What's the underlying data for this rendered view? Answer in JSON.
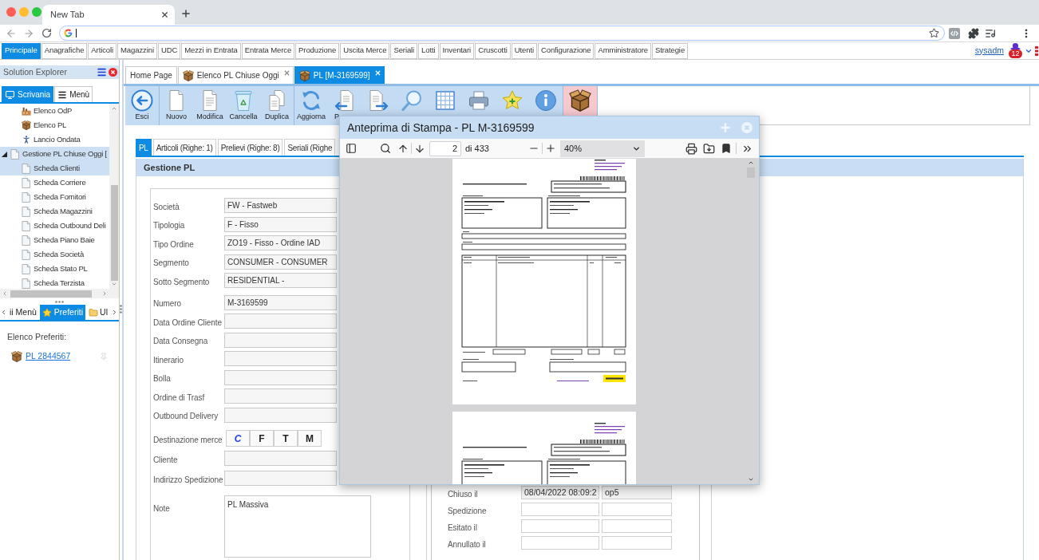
{
  "browser": {
    "tabs": [
      {
        "label": "New Tab",
        "selected": true
      }
    ]
  },
  "menu_bar": {
    "items": [
      {
        "label": "Principale",
        "selected": true
      },
      {
        "label": "Anagrafiche",
        "selected": false
      },
      {
        "label": "Articoli",
        "selected": false
      },
      {
        "label": "Magazzini",
        "selected": false
      },
      {
        "label": "UDC",
        "selected": false
      },
      {
        "label": "Mezzi in Entrata",
        "selected": false
      },
      {
        "label": "Entrata Merce",
        "selected": false
      },
      {
        "label": "Produzione",
        "selected": false
      },
      {
        "label": "Uscita Merce",
        "selected": false
      },
      {
        "label": "Seriali",
        "selected": false
      },
      {
        "label": "Lotti",
        "selected": false
      },
      {
        "label": "Inventari",
        "selected": false
      },
      {
        "label": "Cruscotti",
        "selected": false
      },
      {
        "label": "Utenti",
        "selected": false
      },
      {
        "label": "Configurazione",
        "selected": false
      },
      {
        "label": "Amministratore",
        "selected": false
      },
      {
        "label": "Strategie",
        "selected": false
      }
    ],
    "user": "sysadm",
    "notifications": "12"
  },
  "solution_explorer": {
    "title": "Solution Explorer",
    "tabs": [
      {
        "label": "Scrivania",
        "kind": "desktop",
        "selected": true
      },
      {
        "label": "Menù",
        "kind": "menu",
        "selected": false
      }
    ],
    "tree": [
      {
        "children": [
          {
            "label": "Elenco OdP",
            "kind": "factory",
            "selected": false
          },
          {
            "label": "Elenco PL",
            "kind": "package",
            "selected": false
          },
          {
            "label": "Lancio Ondata",
            "kind": "person",
            "selected": false
          }
        ]
      },
      {
        "label": "Gestione PL Chiuse Oggi [",
        "kind": "page",
        "selected": true,
        "expanded": true,
        "children": [
          {
            "label": "Scheda Clienti",
            "kind": "page",
            "selected": true
          },
          {
            "label": "Scheda Corriere",
            "kind": "page",
            "selected": false
          },
          {
            "label": "Scheda Fornitori",
            "kind": "page",
            "selected": false
          },
          {
            "label": "Scheda Magazzini",
            "kind": "page",
            "selected": false
          },
          {
            "label": "Scheda Outbound Deli",
            "kind": "page",
            "selected": false
          },
          {
            "label": "Scheda Piano Baie",
            "kind": "page",
            "selected": false
          },
          {
            "label": "Scheda Società",
            "kind": "page",
            "selected": false
          },
          {
            "label": "Scheda Stato PL",
            "kind": "page",
            "selected": false
          },
          {
            "label": "Scheda Terzista",
            "kind": "page",
            "selected": false
          }
        ]
      }
    ],
    "bottom_tabs": [
      {
        "label": "ii Menù",
        "kind": "plain",
        "selected": false
      },
      {
        "label": "Preferiti",
        "kind": "star",
        "selected": true
      },
      {
        "label": "Ul",
        "kind": "folder",
        "selected": false
      }
    ],
    "favorites": {
      "title": "Elenco Preferiti:",
      "items": [
        {
          "label": "PL 2844567",
          "kind": "package"
        }
      ]
    }
  },
  "tabs": [
    {
      "label": "Home Page",
      "kind": "plain",
      "selected": false,
      "closable": false
    },
    {
      "label": "Elenco PL Chiuse Oggi",
      "kind": "package",
      "selected": false,
      "closable": true
    },
    {
      "label": "PL [M-3169599]",
      "kind": "package",
      "selected": true,
      "closable": true
    }
  ],
  "toolbar": {
    "groups": [
      {
        "highlighted": false,
        "buttons": [
          {
            "kind": "exit",
            "label": "Esci"
          }
        ]
      },
      {
        "highlighted": false,
        "buttons": [
          {
            "kind": "new",
            "label": "Nuovo"
          },
          {
            "kind": "edit",
            "label": "Modifica"
          },
          {
            "kind": "delete",
            "label": "Cancella"
          },
          {
            "kind": "duplicate",
            "label": "Duplica"
          }
        ]
      },
      {
        "highlighted": false,
        "buttons": [
          {
            "kind": "refresh",
            "label": "Aggiorna"
          },
          {
            "kind": "import",
            "label": "P"
          },
          {
            "kind": "export"
          },
          {
            "kind": "search"
          },
          {
            "kind": "grid"
          },
          {
            "kind": "print"
          },
          {
            "kind": "favorite"
          },
          {
            "kind": "info"
          }
        ]
      },
      {
        "highlighted": true,
        "buttons": [
          {
            "kind": "package"
          }
        ]
      }
    ]
  },
  "form_tabs": [
    {
      "label": "PL",
      "selected": true
    },
    {
      "label": "Articoli (Righe: 1)",
      "selected": false
    },
    {
      "label": "Prelievi (Righe: 8)",
      "selected": false
    },
    {
      "label": "Seriali (Righe",
      "selected": false
    }
  ],
  "panel": {
    "title": "Gestione PL",
    "field_groups": [
      {
        "fields": [
          {
            "kind": "text",
            "label": "Società",
            "value": "FW - Fastweb"
          },
          {
            "kind": "text",
            "label": "Tipologia",
            "value": "F - Fisso"
          },
          {
            "kind": "text",
            "label": "Tipo Ordine",
            "value": "ZO19 - Fisso - Ordine IAD"
          },
          {
            "kind": "text",
            "label": "Segmento",
            "value": "CONSUMER - CONSUMER"
          },
          {
            "kind": "text",
            "label": "Sotto Segmento",
            "value": "RESIDENTIAL -"
          }
        ]
      },
      {
        "fields": [
          {
            "kind": "text",
            "label": "Numero",
            "value": "M-3169599"
          },
          {
            "kind": "text",
            "label": "Data Ordine Cliente"
          },
          {
            "kind": "text",
            "label": "Data Consegna"
          },
          {
            "kind": "text",
            "label": "Itinerario"
          },
          {
            "kind": "text",
            "label": "Bolla"
          },
          {
            "kind": "text",
            "label": "Ordine di Trasf"
          },
          {
            "kind": "text",
            "label": "Outbound Delivery"
          }
        ]
      },
      {
        "fields": [
          {
            "kind": "choice",
            "label": "Destinazione merce",
            "options": [
              {
                "label": "C",
                "selected": true
              },
              {
                "label": "F",
                "selected": false
              },
              {
                "label": "T",
                "selected": false
              },
              {
                "label": "M",
                "selected": false
              }
            ]
          },
          {
            "kind": "text",
            "label": "Cliente"
          },
          {
            "kind": "text",
            "label": "Indirizzo Spedizione"
          }
        ]
      },
      {
        "fields": [
          {
            "kind": "textarea",
            "label": "Note",
            "value": "PL Massiva"
          }
        ]
      }
    ],
    "status_rows": [
      {
        "label": "Chiuso il",
        "values": [
          "08/04/2022 08:09:2",
          "op5"
        ]
      },
      {
        "label": "Spedizione"
      },
      {
        "label": "Esitato il"
      },
      {
        "label": "Annullato il"
      }
    ]
  },
  "print_preview": {
    "title": "Anteprima di Stampa - PL M-3169599",
    "page": "2",
    "page_count": "di 433",
    "zoom": "40%"
  }
}
